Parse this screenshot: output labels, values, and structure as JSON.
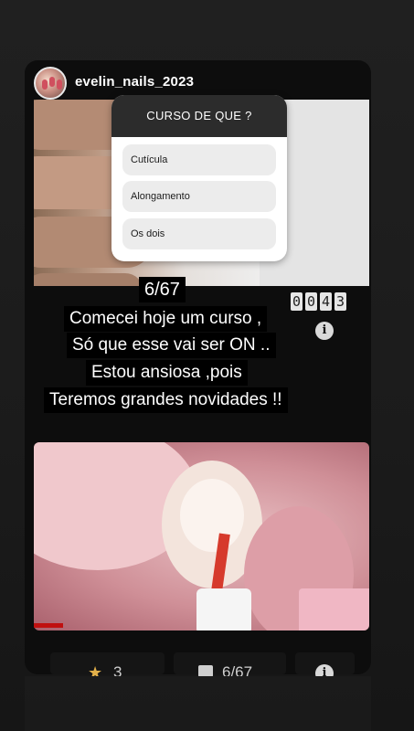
{
  "profile": {
    "username": "evelin_nails_2023"
  },
  "poll": {
    "title": "CURSO DE QUE ?",
    "options": [
      {
        "label": "Cutícula"
      },
      {
        "label": "Alongamento"
      },
      {
        "label": "Os dois"
      }
    ]
  },
  "caption": {
    "counter": "6/67",
    "lines": [
      "Comecei hoje um curso ,",
      "Só que esse vai ser ON ..",
      "Estou  ansiosa ,pois",
      "Teremos grandes novidades !!"
    ]
  },
  "timer": {
    "digits": [
      "0",
      "0",
      "4",
      "3"
    ]
  },
  "bottom_bar": {
    "stars": "3",
    "pages": "6/67"
  },
  "icons": {
    "info": "info-icon",
    "star": "star-icon",
    "list": "list-icon"
  },
  "colors": {
    "background": "#1d1d1d",
    "poll_header": "#2c2c2c",
    "option_bg": "#ececec",
    "progress": "#c01010",
    "star": "#e2b04a"
  }
}
